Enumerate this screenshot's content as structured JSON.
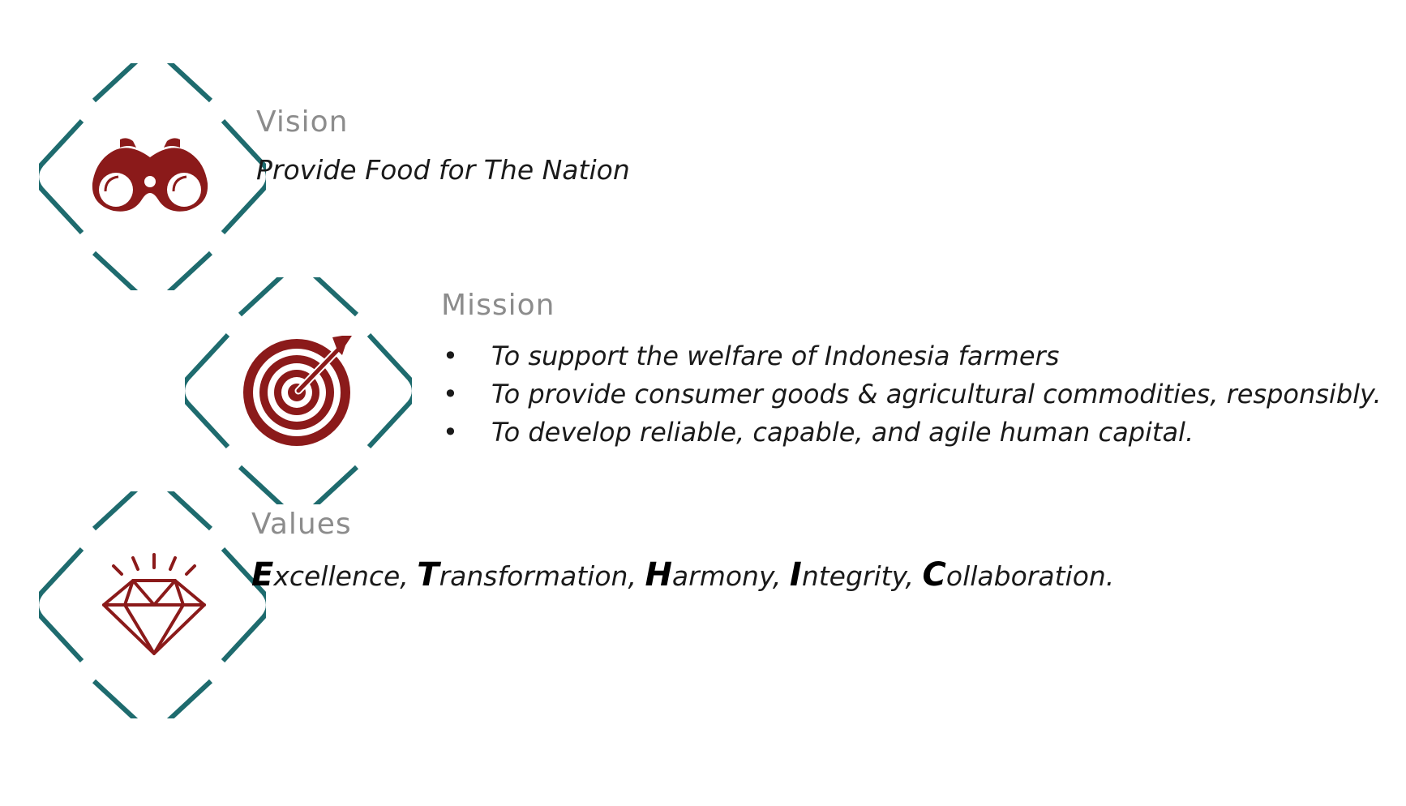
{
  "colors": {
    "frame": "#1e6b6e",
    "icon": "#8b1a1a",
    "heading": "#8c8c8c",
    "text": "#1a1a1a"
  },
  "vision": {
    "icon": "binoculars-icon",
    "heading": "Vision",
    "statement": "Provide Food for The Nation"
  },
  "mission": {
    "icon": "target-icon",
    "heading": "Mission",
    "bullet": "•",
    "items": [
      "To support the welfare of Indonesia farmers",
      "To provide consumer goods & agricultural commodities, responsibly.",
      "To develop reliable, capable, and agile human capital."
    ]
  },
  "values": {
    "icon": "diamond-icon",
    "heading": "Values",
    "items": [
      {
        "initial": "E",
        "rest": "xcellence, "
      },
      {
        "initial": "T",
        "rest": "ransformation, "
      },
      {
        "initial": "H",
        "rest": "armony, "
      },
      {
        "initial": "I",
        "rest": "ntegrity, "
      },
      {
        "initial": "C",
        "rest": "ollaboration."
      }
    ]
  }
}
